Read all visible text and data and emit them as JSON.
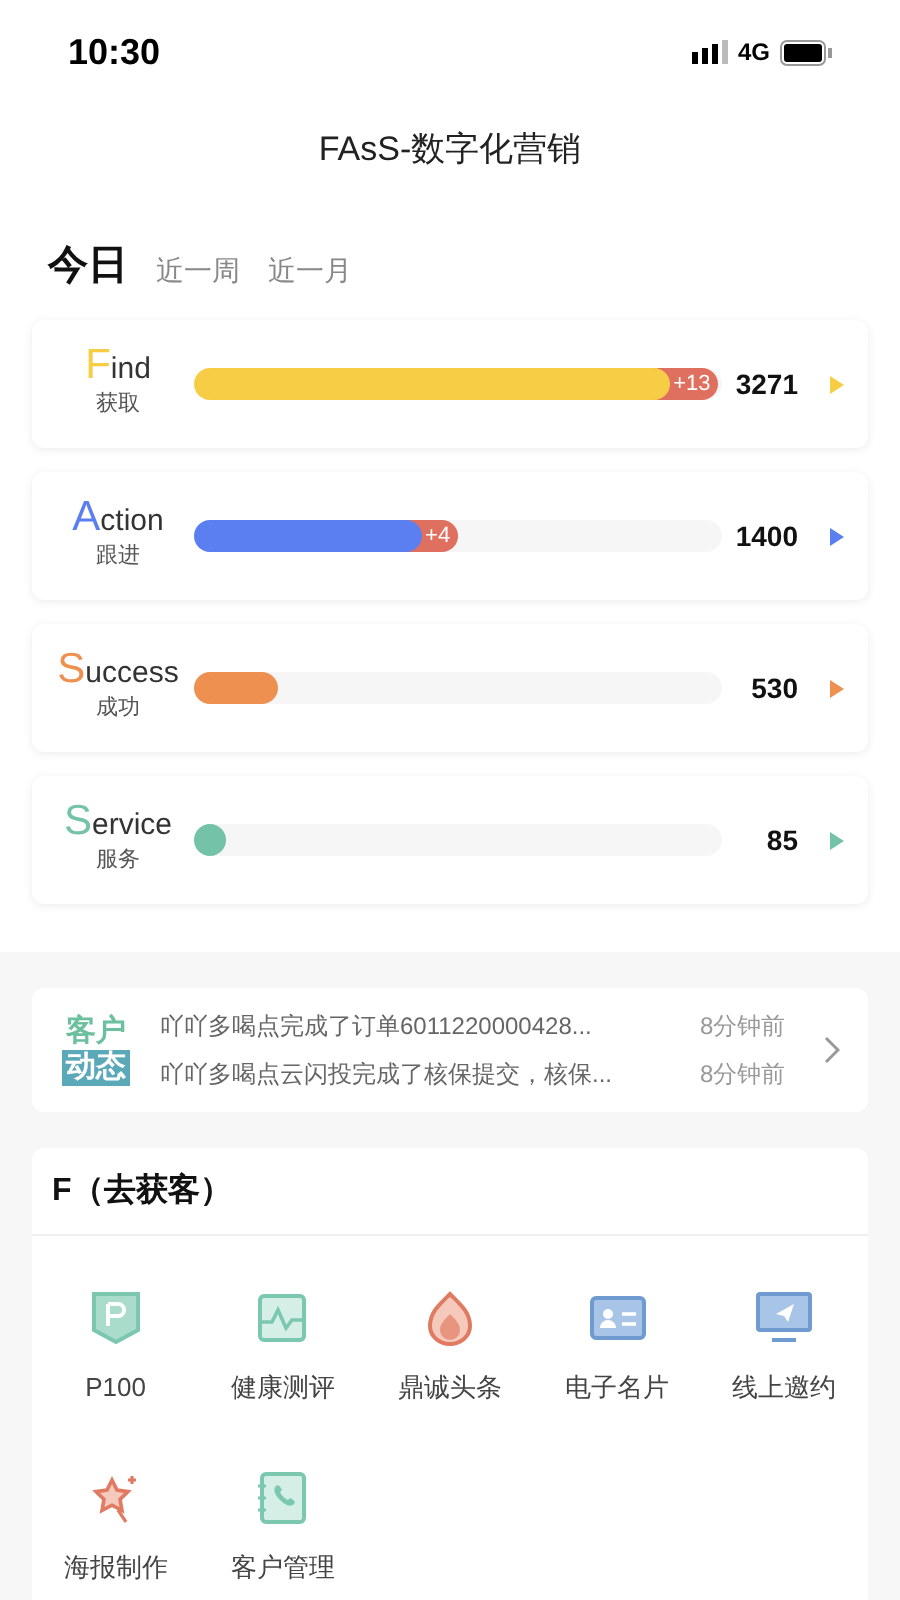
{
  "status_bar": {
    "time": "10:30",
    "network": "4G"
  },
  "title": "FAsS-数字化营销",
  "tabs": [
    {
      "label": "今日",
      "selected": true
    },
    {
      "label": "近一周",
      "selected": false
    },
    {
      "label": "近一月",
      "selected": false
    }
  ],
  "funnel": [
    {
      "initial": "F",
      "rest": "ind",
      "subtitle": "获取",
      "color": "#f8cd46",
      "level": 0.9,
      "increment": "+13",
      "value": "3271"
    },
    {
      "initial": "A",
      "rest": "ction",
      "subtitle": "跟进",
      "color": "#5b7ff0",
      "level": 0.43,
      "increment": "+4",
      "value": "1400"
    },
    {
      "initial": "S",
      "rest": "uccess",
      "subtitle": "成功",
      "color": "#ee9150",
      "level": 0.16,
      "value": "530"
    },
    {
      "initial": "S",
      "rest": "ervice",
      "subtitle": "服务",
      "color": "#74c3a8",
      "level": 0.05,
      "value": "85"
    }
  ],
  "news": {
    "badge_top": "客户",
    "badge_bottom": "动态",
    "items": [
      {
        "text": "吖吖多喝点完成了订单6011220000428...",
        "time": "8分钟前"
      },
      {
        "text": "吖吖多喝点云闪投完成了核保提交，核保...",
        "time": "8分钟前"
      }
    ]
  },
  "section": {
    "title": "F（去获客）",
    "tools": [
      {
        "label": "P100",
        "kind": "badge"
      },
      {
        "label": "健康测评",
        "kind": "pulse"
      },
      {
        "label": "鼎诚头条",
        "kind": "flame"
      },
      {
        "label": "电子名片",
        "kind": "card"
      },
      {
        "label": "线上邀约",
        "kind": "screen"
      },
      {
        "label": "海报制作",
        "kind": "star"
      },
      {
        "label": "客户管理",
        "kind": "phone"
      }
    ]
  }
}
